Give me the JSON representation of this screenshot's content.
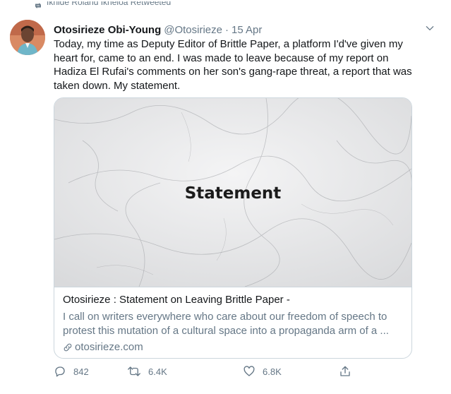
{
  "retweet_context": {
    "text": "Ikhide Roland Ikheloa Retweeted",
    "icon": "retweet-icon"
  },
  "tweet": {
    "author": {
      "display_name": "Otosirieze Obi-Young",
      "handle": "@Otosirieze",
      "avatar_icon": "avatar"
    },
    "separator": "·",
    "date": "15 Apr",
    "text": "Today, my time as Deputy Editor of Brittle Paper, a platform I'd've given my heart for, came to an end. I was made to leave because of my report on Hadiza El Rufai's comments on her son's gang-rape threat, a report that was taken down. My statement.",
    "card": {
      "image_text": "Statement",
      "title": "Otosirieze : Statement on Leaving Brittle Paper -",
      "description": "I call on writers everywhere who care about our freedom of speech to protest this mutation of a cultural space into a propaganda arm of a ...",
      "domain": "otosirieze.com",
      "domain_icon": "link-icon"
    },
    "actions": {
      "replies": "842",
      "retweets": "6.4K",
      "likes": "6.8K",
      "share_icon": "share-icon"
    }
  },
  "colors": {
    "text_primary": "#14171a",
    "text_secondary": "#657786",
    "border": "#ccd6dd",
    "card_image_bg": "#e9eaec"
  }
}
